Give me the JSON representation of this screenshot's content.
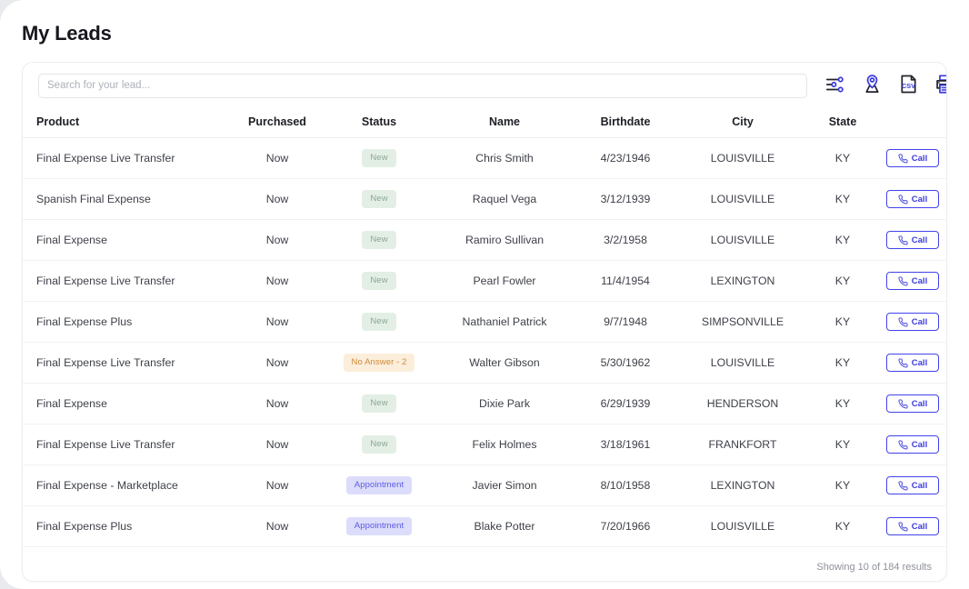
{
  "page": {
    "title": "My Leads"
  },
  "search": {
    "placeholder": "Search for your lead...",
    "value": ""
  },
  "toolbar": {
    "icons": [
      {
        "name": "filter-sliders-icon",
        "label": "Filters"
      },
      {
        "name": "map-pin-icon",
        "label": "Map view"
      },
      {
        "name": "csv-export-icon",
        "label": "Export CSV"
      },
      {
        "name": "printer-icon",
        "label": "Print"
      }
    ]
  },
  "table": {
    "columns": [
      "Product",
      "Purchased",
      "Status",
      "Name",
      "Birthdate",
      "City",
      "State",
      ""
    ],
    "action_label": "Call",
    "rows": [
      {
        "product": "Final Expense Live Transfer",
        "purchased": "Now",
        "status": "New",
        "status_kind": "new",
        "name": "Chris Smith",
        "birthdate": "4/23/1946",
        "city": "LOUISVILLE",
        "state": "KY"
      },
      {
        "product": "Spanish Final Expense",
        "purchased": "Now",
        "status": "New",
        "status_kind": "new",
        "name": "Raquel Vega",
        "birthdate": "3/12/1939",
        "city": "LOUISVILLE",
        "state": "KY"
      },
      {
        "product": "Final Expense",
        "purchased": "Now",
        "status": "New",
        "status_kind": "new",
        "name": "Ramiro Sullivan",
        "birthdate": "3/2/1958",
        "city": "LOUISVILLE",
        "state": "KY"
      },
      {
        "product": "Final Expense Live Transfer",
        "purchased": "Now",
        "status": "New",
        "status_kind": "new",
        "name": "Pearl Fowler",
        "birthdate": "11/4/1954",
        "city": "LEXINGTON",
        "state": "KY"
      },
      {
        "product": "Final Expense Plus",
        "purchased": "Now",
        "status": "New",
        "status_kind": "new",
        "name": "Nathaniel Patrick",
        "birthdate": "9/7/1948",
        "city": "SIMPSONVILLE",
        "state": "KY"
      },
      {
        "product": "Final Expense Live Transfer",
        "purchased": "Now",
        "status": "No Answer - 2",
        "status_kind": "noanswer",
        "name": "Walter Gibson",
        "birthdate": "5/30/1962",
        "city": "LOUISVILLE",
        "state": "KY"
      },
      {
        "product": "Final Expense",
        "purchased": "Now",
        "status": "New",
        "status_kind": "new",
        "name": "Dixie Park",
        "birthdate": "6/29/1939",
        "city": "HENDERSON",
        "state": "KY"
      },
      {
        "product": "Final Expense Live Transfer",
        "purchased": "Now",
        "status": "New",
        "status_kind": "new",
        "name": "Felix Holmes",
        "birthdate": "3/18/1961",
        "city": "FRANKFORT",
        "state": "KY"
      },
      {
        "product": "Final Expense - Marketplace",
        "purchased": "Now",
        "status": "Appointment",
        "status_kind": "appointment",
        "name": "Javier Simon",
        "birthdate": "8/10/1958",
        "city": "LEXINGTON",
        "state": "KY"
      },
      {
        "product": "Final Expense Plus",
        "purchased": "Now",
        "status": "Appointment",
        "status_kind": "appointment",
        "name": "Blake Potter",
        "birthdate": "7/20/1966",
        "city": "LOUISVILLE",
        "state": "KY"
      }
    ]
  },
  "footer": {
    "results_text": "Showing 10 of 184 results"
  },
  "colors": {
    "accent": "#4343ea",
    "badge_new_bg": "#e3efe5",
    "badge_new_text": "#8aa793",
    "badge_noanswer_bg": "#fbeedb",
    "badge_noanswer_text": "#cf8a3c",
    "badge_appointment_bg": "#dcdcfb",
    "badge_appointment_text": "#5b5be0"
  }
}
